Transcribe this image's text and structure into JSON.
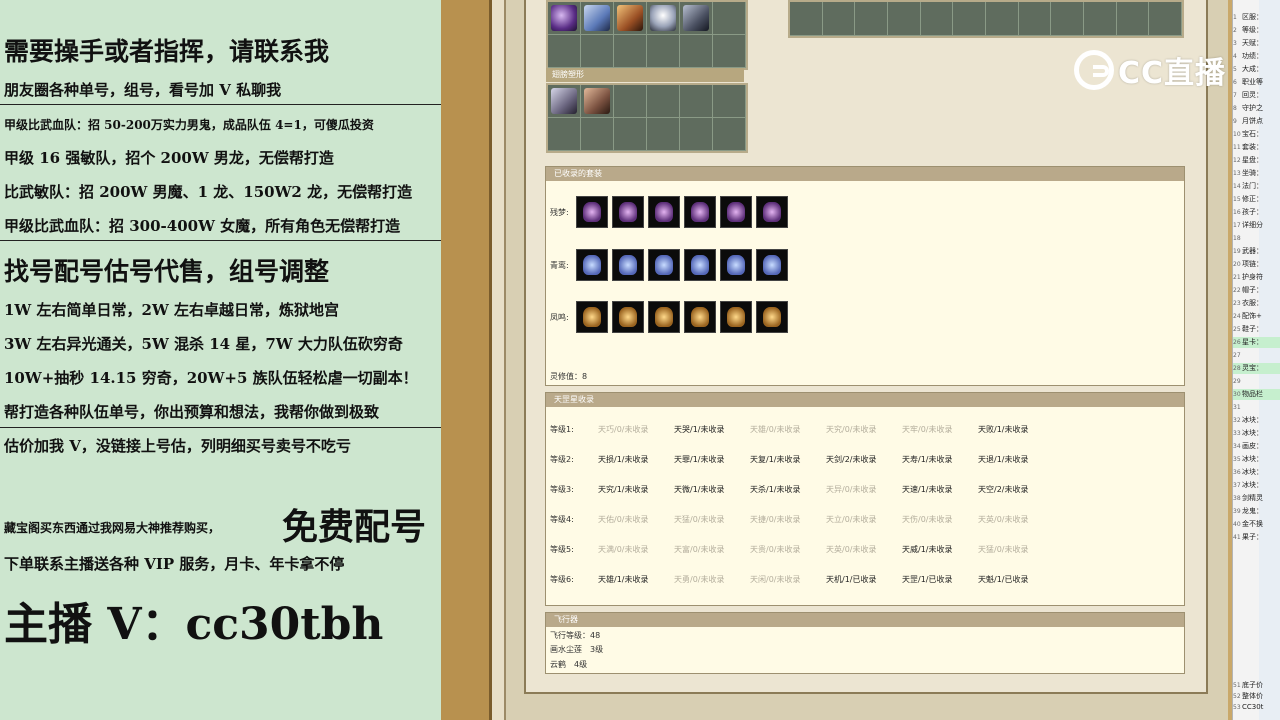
{
  "promo": {
    "lines": [
      "需要操手或者指挥，请联系我",
      "朋友圈各种单号，组号，看号加 V 私聊我",
      "甲级比武血队：招 50-200万实力男鬼，成品队伍 4=1，可傻瓜投资",
      "甲级 16 强敏队，招个 200W 男龙，无偿帮打造",
      "比武敏队：招 200W 男魔、1 龙、150W2 龙，无偿帮打造",
      "甲级比武血队：招 300-400W 女魔，所有角色无偿帮打造",
      "找号配号估号代售，组号调整",
      "1W 左右简单日常，2W 左右卓越日常，炼狱地宫",
      "3W 左右异光通关，5W 混杀 14 星，7W 大力队伍砍穷奇",
      "10W+抽秒 14.15 穷奇，20W+5 族队伍轻松虐一切副本！",
      "帮打造各种队伍单号，你出预算和想法，我帮你做到极致",
      "估价加我 V，没链接上号估，列明细买号卖号不吃亏",
      "藏宝阁买东西通过我网易大神推荐购买，",
      "下单联系主播送各种 VIP 服务，月卡、年卡拿不停"
    ],
    "free_config": "免费配号",
    "anchor_v": "主播 V：cc30tbh"
  },
  "panel": {
    "wing_bar": "翅膀塑形",
    "costume_section": {
      "title": "已收录的套装",
      "rows": [
        {
          "label": "残梦:"
        },
        {
          "label": "青鸾:"
        },
        {
          "label": "凤鸣:"
        }
      ],
      "spirit": "灵修值：8"
    },
    "star_section": {
      "title": "天罡星收录",
      "rows": [
        {
          "level": "等级1:",
          "stars": [
            [
              "天巧/0/未收录",
              false
            ],
            [
              "天哭/1/未收录",
              true
            ],
            [
              "天雄/0/未收录",
              false
            ],
            [
              "天究/0/未收录",
              false
            ],
            [
              "天牢/0/未收录",
              false
            ],
            [
              "天败/1/未收录",
              true
            ]
          ]
        },
        {
          "level": "等级2:",
          "stars": [
            [
              "天损/1/未收录",
              true
            ],
            [
              "天罪/1/未收录",
              true
            ],
            [
              "天复/1/未收录",
              true
            ],
            [
              "天剑/2/未收录",
              true
            ],
            [
              "天寿/1/未收录",
              true
            ],
            [
              "天退/1/未收录",
              true
            ]
          ]
        },
        {
          "level": "等级3:",
          "stars": [
            [
              "天究/1/未收录",
              true
            ],
            [
              "天微/1/未收录",
              true
            ],
            [
              "天杀/1/未收录",
              true
            ],
            [
              "天异/0/未收录",
              false
            ],
            [
              "天速/1/未收录",
              true
            ],
            [
              "天空/2/未收录",
              true
            ]
          ]
        },
        {
          "level": "等级4:",
          "stars": [
            [
              "天佑/0/未收录",
              false
            ],
            [
              "天猛/0/未收录",
              false
            ],
            [
              "天捷/0/未收录",
              false
            ],
            [
              "天立/0/未收录",
              false
            ],
            [
              "天伤/0/未收录",
              false
            ],
            [
              "天英/0/未收录",
              false
            ]
          ]
        },
        {
          "level": "等级5:",
          "stars": [
            [
              "天满/0/未收录",
              false
            ],
            [
              "天富/0/未收录",
              false
            ],
            [
              "天贵/0/未收录",
              false
            ],
            [
              "天英/0/未收录",
              false
            ],
            [
              "天威/1/未收录",
              true
            ],
            [
              "天猛/0/未收录",
              false
            ]
          ]
        },
        {
          "level": "等级6:",
          "stars": [
            [
              "天雄/1/未收录",
              true
            ],
            [
              "天勇/0/未收录",
              false
            ],
            [
              "天闲/0/未收录",
              false
            ],
            [
              "天机/1/已收录",
              true
            ],
            [
              "天罡/1/已收录",
              true
            ],
            [
              "天魁/1/已收录",
              true
            ]
          ]
        }
      ]
    },
    "fly_section": {
      "title": "飞行器",
      "rows": [
        "飞行等级：48",
        "画水尘莲　3级",
        "云鹤　4级"
      ]
    }
  },
  "logo": {
    "text": "CC直播"
  },
  "right_strip": {
    "rows": [
      {
        "n": "1",
        "t": "区服：",
        "g": false
      },
      {
        "n": "2",
        "t": "等级：",
        "g": false
      },
      {
        "n": "3",
        "t": "天赋：",
        "g": false
      },
      {
        "n": "4",
        "t": "功绩：",
        "g": false
      },
      {
        "n": "5",
        "t": "大成：",
        "g": false
      },
      {
        "n": "6",
        "t": "职业等",
        "g": false
      },
      {
        "n": "7",
        "t": "回灵：",
        "g": false
      },
      {
        "n": "8",
        "t": "守护之",
        "g": false
      },
      {
        "n": "9",
        "t": "月饼点",
        "g": false
      },
      {
        "n": "10",
        "t": "宝石：",
        "g": false
      },
      {
        "n": "11",
        "t": "套装：",
        "g": false
      },
      {
        "n": "12",
        "t": "星盘：",
        "g": false
      },
      {
        "n": "13",
        "t": "坐骑：",
        "g": false
      },
      {
        "n": "14",
        "t": "法门：",
        "g": false
      },
      {
        "n": "15",
        "t": "修正：",
        "g": false
      },
      {
        "n": "16",
        "t": "孩子：",
        "g": false
      },
      {
        "n": "17",
        "t": "详细分",
        "g": false
      },
      {
        "n": "18",
        "t": "",
        "g": false
      },
      {
        "n": "19",
        "t": "武器：",
        "g": false
      },
      {
        "n": "20",
        "t": "项链：",
        "g": false
      },
      {
        "n": "21",
        "t": "护身符",
        "g": false
      },
      {
        "n": "22",
        "t": "帽子：",
        "g": false
      },
      {
        "n": "23",
        "t": "衣服：",
        "g": false
      },
      {
        "n": "24",
        "t": "配饰+",
        "g": false
      },
      {
        "n": "25",
        "t": "鞋子：",
        "g": false
      },
      {
        "n": "26",
        "t": "星卡：",
        "g": true
      },
      {
        "n": "27",
        "t": "",
        "g": false
      },
      {
        "n": "28",
        "t": "灵宝：",
        "g": true
      },
      {
        "n": "29",
        "t": "",
        "g": false
      },
      {
        "n": "30",
        "t": "物品栏",
        "g": true
      },
      {
        "n": "31",
        "t": "",
        "g": false
      },
      {
        "n": "32",
        "t": "冰块：",
        "g": false
      },
      {
        "n": "33",
        "t": "冰块：",
        "g": false
      },
      {
        "n": "34",
        "t": "画皮：",
        "g": false
      },
      {
        "n": "35",
        "t": "冰块：",
        "g": false
      },
      {
        "n": "36",
        "t": "冰块：",
        "g": false
      },
      {
        "n": "37",
        "t": "冰块：",
        "g": false
      },
      {
        "n": "38",
        "t": "剑精灵",
        "g": false
      },
      {
        "n": "39",
        "t": "龙鬼：",
        "g": false
      },
      {
        "n": "40",
        "t": "金不换",
        "g": false
      },
      {
        "n": "41",
        "t": "果子：",
        "g": false
      },
      {
        "n": "51",
        "t": "底子价",
        "g": false
      },
      {
        "n": "52",
        "t": "整体价",
        "g": false
      },
      {
        "n": "53",
        "t": "CC30t",
        "g": false
      }
    ]
  }
}
